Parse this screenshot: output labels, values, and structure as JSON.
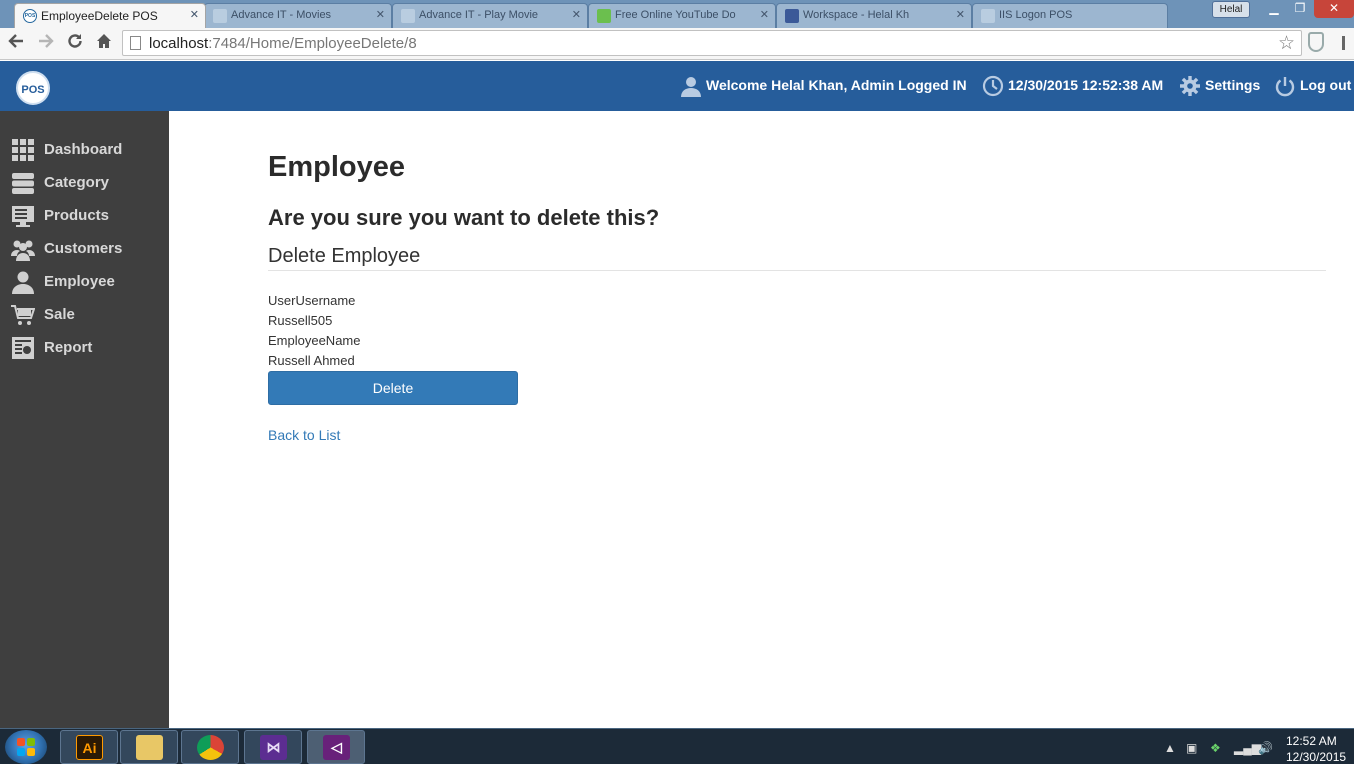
{
  "browser": {
    "active_tab_title": "EmployeeDelete POS",
    "active_tab_favicon": "POS",
    "window_user": "Helal",
    "url_host": "localhost",
    "url_path": ":7484/Home/EmployeeDelete/8",
    "background_tabs": [
      {
        "title": "Advance IT - Movies",
        "icon": "page-icon"
      },
      {
        "title": "Advance IT - Play Movie",
        "icon": "page-icon"
      },
      {
        "title": "Free Online YouTube Do",
        "icon": "download-icon"
      },
      {
        "title": "Workspace - Helal Kh",
        "icon": "facebook-icon"
      },
      {
        "title": "IIS Logon POS",
        "icon": "page-icon"
      }
    ]
  },
  "header": {
    "logo_text": "POS",
    "welcome": "Welcome Helal Khan, Admin Logged IN",
    "datetime": "12/30/2015 12:52:38 AM",
    "settings": "Settings",
    "logout": "Log out"
  },
  "sidebar": {
    "items": [
      {
        "label": "Dashboard",
        "icon": "grid-icon"
      },
      {
        "label": "Category",
        "icon": "server-icon"
      },
      {
        "label": "Products",
        "icon": "monitor-list-icon"
      },
      {
        "label": "Customers",
        "icon": "users-icon"
      },
      {
        "label": "Employee",
        "icon": "user-icon"
      },
      {
        "label": "Sale",
        "icon": "cart-icon"
      },
      {
        "label": "Report",
        "icon": "report-icon"
      }
    ]
  },
  "main": {
    "page_title": "Employee",
    "confirm_question": "Are you sure you want to delete this?",
    "section_title": "Delete Employee",
    "fields": [
      {
        "label": "UserUsername",
        "value": "Russell505"
      },
      {
        "label": "EmployeeName",
        "value": "Russell Ahmed"
      }
    ],
    "delete_label": "Delete",
    "back_label": "Back to List"
  },
  "taskbar": {
    "apps": [
      "Adobe Illustrator",
      "File Explorer",
      "Google Chrome",
      "Visual Studio",
      "Visual Studio 2015"
    ],
    "illustrator_label": "Ai",
    "time": "12:52 AM",
    "date": "12/30/2015"
  },
  "colors": {
    "header_blue": "#265d9b",
    "sidebar_dark": "#3f3f3f",
    "primary_button": "#337ab7",
    "link": "#337ab7"
  }
}
